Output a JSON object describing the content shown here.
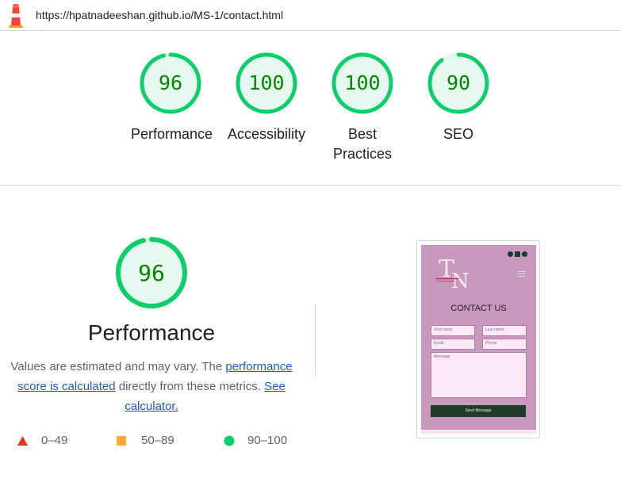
{
  "url": "https://hpatnadeeshan.github.io/MS-1/contact.html",
  "scores": [
    {
      "label": "Performance",
      "value": "96",
      "percent": 96
    },
    {
      "label": "Accessibility",
      "value": "100",
      "percent": 100
    },
    {
      "label": "Best Practices",
      "value": "100",
      "percent": 100
    },
    {
      "label": "SEO",
      "value": "90",
      "percent": 90
    }
  ],
  "detail": {
    "title": "Performance",
    "score": "96",
    "percent": 96,
    "desc_prefix": "Values are estimated and may vary. The ",
    "link1": "performance score is calculated",
    "desc_middle": " directly from these metrics. ",
    "link2": "See calculator."
  },
  "legend": [
    {
      "range": "0–49",
      "shape": "triangle",
      "color": "#eb3323"
    },
    {
      "range": "50–89",
      "shape": "square",
      "color": "#ffaa33"
    },
    {
      "range": "90–100",
      "shape": "circle",
      "color": "#0cce6b"
    }
  ],
  "colors": {
    "pass_ring": "#0cce6b",
    "pass_fill": "#e6f8ef",
    "pass_text": "#008800",
    "ring_track": "#e1f5ea"
  },
  "phone_preview": {
    "heading": "CONTACT US",
    "first_name_placeholder": "First name",
    "last_name_placeholder": "Last name",
    "email_placeholder": "Email",
    "phone_placeholder": "Phone",
    "message_placeholder": "Message",
    "send_label": "Send Message"
  }
}
